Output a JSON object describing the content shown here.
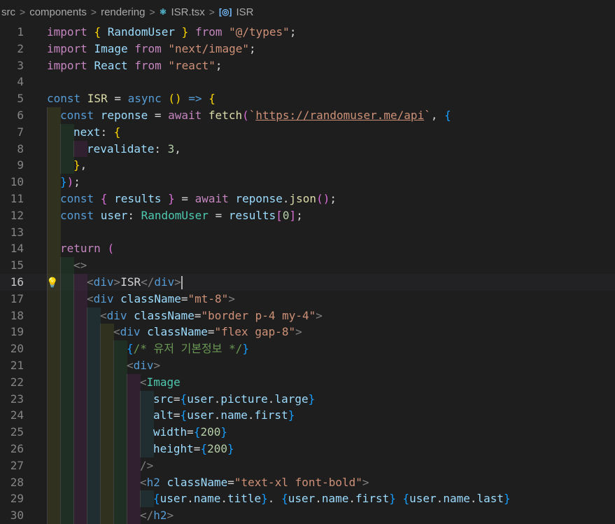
{
  "breadcrumb": {
    "items": [
      "src",
      "components",
      "rendering",
      "ISR.tsx",
      "ISR"
    ],
    "file_icon": "⚛",
    "symbol_icon": "[◎]"
  },
  "editor": {
    "active_line": 16,
    "lines": [
      {
        "n": 1,
        "guides": 0,
        "tokens": [
          [
            "import ",
            "kc"
          ],
          [
            "{ ",
            "b1"
          ],
          [
            "RandomUser ",
            "id"
          ],
          [
            "} ",
            "b1"
          ],
          [
            "from ",
            "kc"
          ],
          [
            "\"@/types\"",
            "st"
          ],
          [
            ";",
            "pl"
          ]
        ]
      },
      {
        "n": 2,
        "guides": 0,
        "tokens": [
          [
            "import ",
            "kc"
          ],
          [
            "Image ",
            "id"
          ],
          [
            "from ",
            "kc"
          ],
          [
            "\"next/image\"",
            "st"
          ],
          [
            ";",
            "pl"
          ]
        ]
      },
      {
        "n": 3,
        "guides": 0,
        "tokens": [
          [
            "import ",
            "kc"
          ],
          [
            "React ",
            "id"
          ],
          [
            "from ",
            "kc"
          ],
          [
            "\"react\"",
            "st"
          ],
          [
            ";",
            "pl"
          ]
        ]
      },
      {
        "n": 4,
        "guides": 0,
        "tokens": []
      },
      {
        "n": 5,
        "guides": 0,
        "tokens": [
          [
            "const ",
            "kw"
          ],
          [
            "ISR ",
            "fn"
          ],
          [
            "= ",
            "pl"
          ],
          [
            "async ",
            "kw"
          ],
          [
            "() ",
            "b1"
          ],
          [
            "=> ",
            "kw"
          ],
          [
            "{",
            "b1"
          ]
        ]
      },
      {
        "n": 6,
        "guides": 1,
        "tokens": [
          [
            "const ",
            "kw"
          ],
          [
            "reponse ",
            "id"
          ],
          [
            "= ",
            "pl"
          ],
          [
            "await ",
            "kc"
          ],
          [
            "fetch",
            "fn"
          ],
          [
            "(",
            "b2"
          ],
          [
            "`",
            "st"
          ],
          [
            "https://randomuser.me/api",
            "st url"
          ],
          [
            "`",
            "st"
          ],
          [
            ", ",
            "pl"
          ],
          [
            "{",
            "b3"
          ]
        ]
      },
      {
        "n": 7,
        "guides": 2,
        "tokens": [
          [
            "next",
            "id"
          ],
          [
            ": ",
            "pl"
          ],
          [
            "{",
            "b1"
          ]
        ]
      },
      {
        "n": 8,
        "guides": 3,
        "tokens": [
          [
            "revalidate",
            "id"
          ],
          [
            ": ",
            "pl"
          ],
          [
            "3",
            "nu"
          ],
          [
            ",",
            "pl"
          ]
        ]
      },
      {
        "n": 9,
        "guides": 2,
        "tokens": [
          [
            "}",
            "b1"
          ],
          [
            ",",
            "pl"
          ]
        ]
      },
      {
        "n": 10,
        "guides": 1,
        "tokens": [
          [
            "}",
            "b3"
          ],
          [
            ")",
            "b2"
          ],
          [
            ";",
            "pl"
          ]
        ]
      },
      {
        "n": 11,
        "guides": 1,
        "tokens": [
          [
            "const ",
            "kw"
          ],
          [
            "{ ",
            "b2"
          ],
          [
            "results ",
            "id"
          ],
          [
            "} ",
            "b2"
          ],
          [
            "= ",
            "pl"
          ],
          [
            "await ",
            "kc"
          ],
          [
            "reponse",
            "id"
          ],
          [
            ".",
            "pl"
          ],
          [
            "json",
            "fn"
          ],
          [
            "()",
            "b2"
          ],
          [
            ";",
            "pl"
          ]
        ]
      },
      {
        "n": 12,
        "guides": 1,
        "tokens": [
          [
            "const ",
            "kw"
          ],
          [
            "user",
            "id"
          ],
          [
            ": ",
            "pl"
          ],
          [
            "RandomUser ",
            "ty"
          ],
          [
            "= ",
            "pl"
          ],
          [
            "results",
            "id"
          ],
          [
            "[",
            "b2"
          ],
          [
            "0",
            "nu"
          ],
          [
            "]",
            "b2"
          ],
          [
            ";",
            "pl"
          ]
        ]
      },
      {
        "n": 13,
        "guides": 1,
        "tokens": []
      },
      {
        "n": 14,
        "guides": 1,
        "tokens": [
          [
            "return ",
            "kc"
          ],
          [
            "(",
            "b2"
          ]
        ]
      },
      {
        "n": 15,
        "guides": 2,
        "tokens": [
          [
            "<>",
            "tg"
          ]
        ]
      },
      {
        "n": 16,
        "guides": 3,
        "tokens": [
          [
            "<",
            "tg"
          ],
          [
            "div",
            "kw"
          ],
          [
            ">",
            "tg"
          ],
          [
            "ISR",
            "pl"
          ],
          [
            "</",
            "tg"
          ],
          [
            "div",
            "kw"
          ],
          [
            ">",
            "tg"
          ]
        ],
        "cursor": true
      },
      {
        "n": 17,
        "guides": 3,
        "tokens": [
          [
            "<",
            "tg"
          ],
          [
            "div ",
            "kw"
          ],
          [
            "className",
            "id"
          ],
          [
            "=",
            "pl"
          ],
          [
            "\"mt-8\"",
            "st"
          ],
          [
            ">",
            "tg"
          ]
        ]
      },
      {
        "n": 18,
        "guides": 4,
        "tokens": [
          [
            "<",
            "tg"
          ],
          [
            "div ",
            "kw"
          ],
          [
            "className",
            "id"
          ],
          [
            "=",
            "pl"
          ],
          [
            "\"border p-4 my-4\"",
            "st"
          ],
          [
            ">",
            "tg"
          ]
        ]
      },
      {
        "n": 19,
        "guides": 5,
        "tokens": [
          [
            "<",
            "tg"
          ],
          [
            "div ",
            "kw"
          ],
          [
            "className",
            "id"
          ],
          [
            "=",
            "pl"
          ],
          [
            "\"flex gap-8\"",
            "st"
          ],
          [
            ">",
            "tg"
          ]
        ]
      },
      {
        "n": 20,
        "guides": 6,
        "tokens": [
          [
            "{",
            "b3"
          ],
          [
            "/* 유저 기본정보 */",
            "cm"
          ],
          [
            "}",
            "b3"
          ]
        ]
      },
      {
        "n": 21,
        "guides": 6,
        "tokens": [
          [
            "<",
            "tg"
          ],
          [
            "div",
            "kw"
          ],
          [
            ">",
            "tg"
          ]
        ]
      },
      {
        "n": 22,
        "guides": 7,
        "tokens": [
          [
            "<",
            "tg"
          ],
          [
            "Image",
            "ty"
          ]
        ]
      },
      {
        "n": 23,
        "guides": 8,
        "tokens": [
          [
            "src",
            "id"
          ],
          [
            "=",
            "pl"
          ],
          [
            "{",
            "b3"
          ],
          [
            "user",
            "id"
          ],
          [
            ".",
            "pl"
          ],
          [
            "picture",
            "id"
          ],
          [
            ".",
            "pl"
          ],
          [
            "large",
            "id"
          ],
          [
            "}",
            "b3"
          ]
        ]
      },
      {
        "n": 24,
        "guides": 8,
        "tokens": [
          [
            "alt",
            "id"
          ],
          [
            "=",
            "pl"
          ],
          [
            "{",
            "b3"
          ],
          [
            "user",
            "id"
          ],
          [
            ".",
            "pl"
          ],
          [
            "name",
            "id"
          ],
          [
            ".",
            "pl"
          ],
          [
            "first",
            "id"
          ],
          [
            "}",
            "b3"
          ]
        ]
      },
      {
        "n": 25,
        "guides": 8,
        "tokens": [
          [
            "width",
            "id"
          ],
          [
            "=",
            "pl"
          ],
          [
            "{",
            "b3"
          ],
          [
            "200",
            "nu"
          ],
          [
            "}",
            "b3"
          ]
        ]
      },
      {
        "n": 26,
        "guides": 8,
        "tokens": [
          [
            "height",
            "id"
          ],
          [
            "=",
            "pl"
          ],
          [
            "{",
            "b3"
          ],
          [
            "200",
            "nu"
          ],
          [
            "}",
            "b3"
          ]
        ]
      },
      {
        "n": 27,
        "guides": 7,
        "tokens": [
          [
            "/>",
            "tg"
          ]
        ]
      },
      {
        "n": 28,
        "guides": 7,
        "tokens": [
          [
            "<",
            "tg"
          ],
          [
            "h2 ",
            "kw"
          ],
          [
            "className",
            "id"
          ],
          [
            "=",
            "pl"
          ],
          [
            "\"text-xl font-bold\"",
            "st"
          ],
          [
            ">",
            "tg"
          ]
        ]
      },
      {
        "n": 29,
        "guides": 8,
        "tokens": [
          [
            "{",
            "b3"
          ],
          [
            "user",
            "id"
          ],
          [
            ".",
            "pl"
          ],
          [
            "name",
            "id"
          ],
          [
            ".",
            "pl"
          ],
          [
            "title",
            "id"
          ],
          [
            "}",
            "b3"
          ],
          [
            ". ",
            "pl"
          ],
          [
            "{",
            "b3"
          ],
          [
            "user",
            "id"
          ],
          [
            ".",
            "pl"
          ],
          [
            "name",
            "id"
          ],
          [
            ".",
            "pl"
          ],
          [
            "first",
            "id"
          ],
          [
            "}",
            "b3"
          ],
          [
            " ",
            "pl"
          ],
          [
            "{",
            "b3"
          ],
          [
            "user",
            "id"
          ],
          [
            ".",
            "pl"
          ],
          [
            "name",
            "id"
          ],
          [
            ".",
            "pl"
          ],
          [
            "last",
            "id"
          ],
          [
            "}",
            "b3"
          ]
        ]
      },
      {
        "n": 30,
        "guides": 7,
        "tokens": [
          [
            "</",
            "tg"
          ],
          [
            "h2",
            "kw"
          ],
          [
            ">",
            "tg"
          ]
        ]
      }
    ]
  }
}
